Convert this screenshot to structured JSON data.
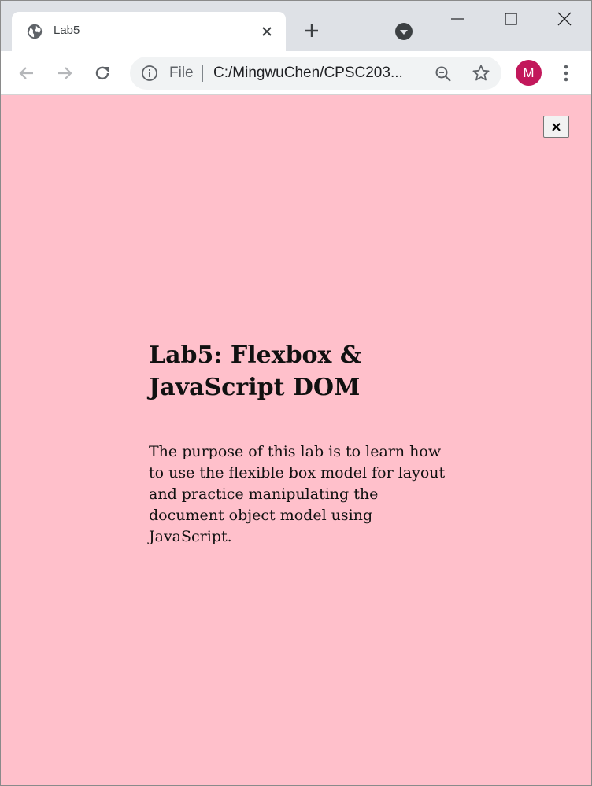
{
  "browser": {
    "tab": {
      "title": "Lab5"
    },
    "omnibox": {
      "scheme_label": "File",
      "url_display": "C:/MingwuChen/CPSC203..."
    },
    "profile": {
      "initial": "M",
      "color": "#c2185b"
    }
  },
  "page": {
    "background": "#ffc0cb",
    "close_label": "×",
    "title": "Lab5: Flexbox & JavaScript DOM",
    "description": "The purpose of this lab is to learn how to use the flexible box model for layout and practice manipulating the document object model using JavaScript."
  }
}
